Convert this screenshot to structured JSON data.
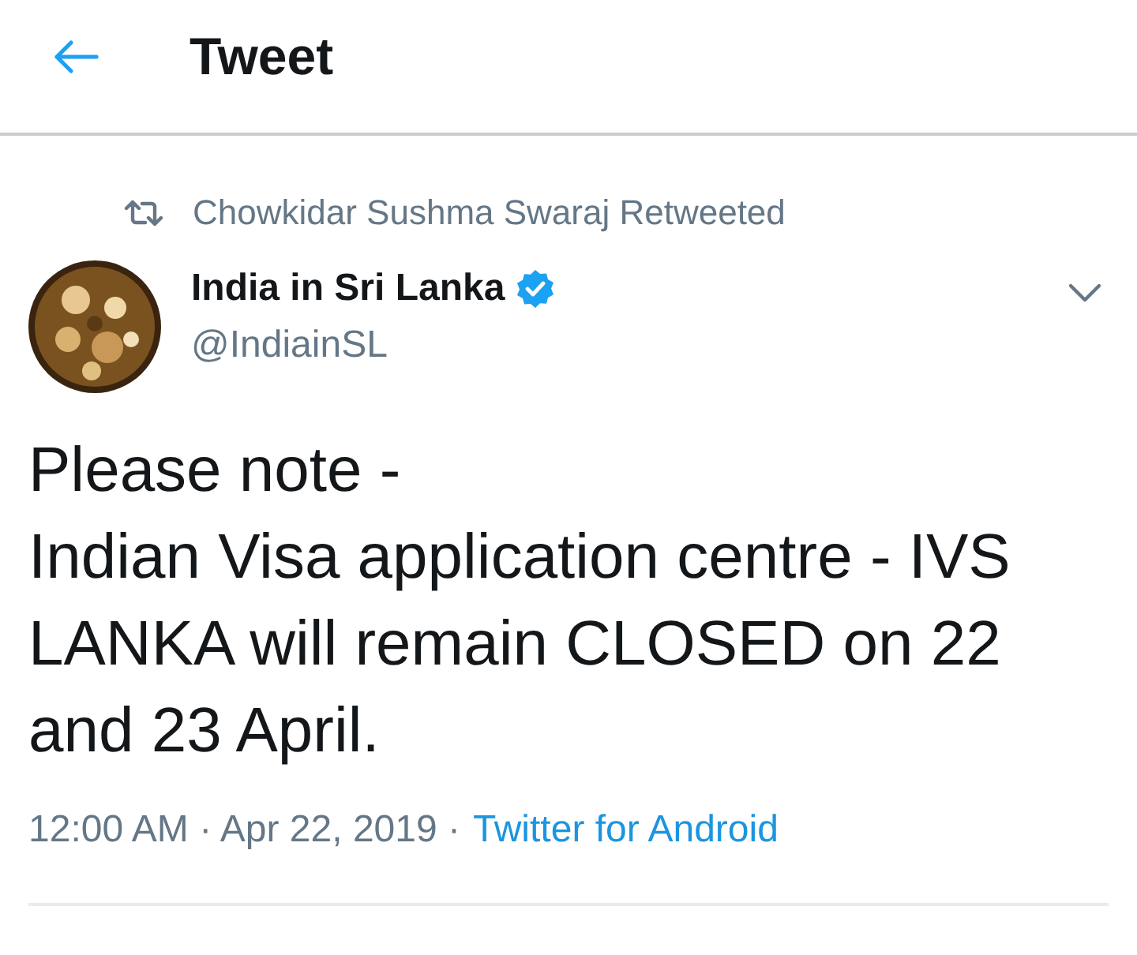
{
  "header": {
    "title": "Tweet"
  },
  "retweet_note": "Chowkidar Sushma Swaraj Retweeted",
  "author": {
    "name": "India in Sri Lanka",
    "verified": true,
    "handle": "@IndiainSL"
  },
  "body": "Please note -\nIndian Visa application centre - IVS LANKA will remain CLOSED on 22 and 23 April.",
  "meta": "12:00 AM · Apr 22, 2019 ·",
  "source": "Twitter for Android"
}
